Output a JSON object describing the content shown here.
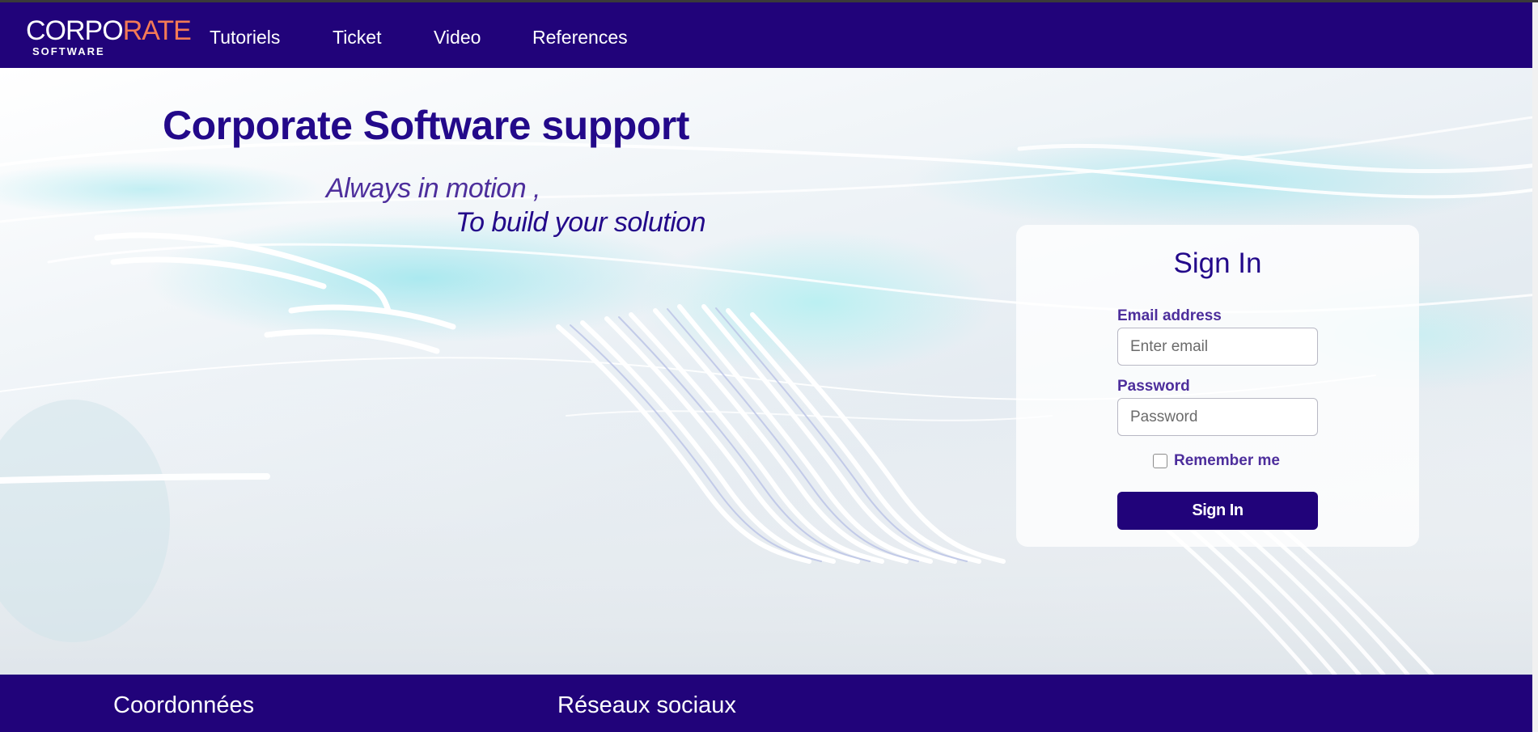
{
  "brand": {
    "logo_part1": "CORPO",
    "logo_part2": "RATE",
    "logo_sub": "SOFTWARE",
    "primary_color": "#21037a",
    "accent_color": "#f47a55"
  },
  "nav": {
    "items": [
      {
        "label": "Tutoriels"
      },
      {
        "label": "Ticket"
      },
      {
        "label": "Video"
      },
      {
        "label": "References"
      }
    ]
  },
  "hero": {
    "title": "Corporate Software support",
    "tagline_line1": "Always in motion ,",
    "tagline_line2": "To build your solution"
  },
  "signin": {
    "title": "Sign In",
    "email_label": "Email address",
    "email_placeholder": "Enter email",
    "email_value": "",
    "password_label": "Password",
    "password_placeholder": "Password",
    "password_value": "",
    "remember_label": "Remember me",
    "remember_checked": false,
    "submit_label": "Sign In"
  },
  "footer": {
    "col1_heading": "Coordonnées",
    "col2_heading": "Réseaux sociaux"
  }
}
